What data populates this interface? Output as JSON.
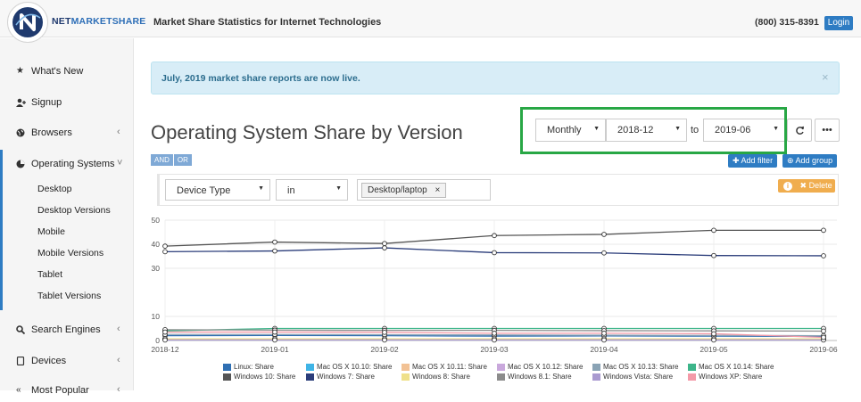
{
  "header": {
    "logo_net": "NET",
    "logo_ms": "MARKETSHARE",
    "tagline": "Market Share Statistics for Internet Technologies",
    "phone": "(800) 315-8391",
    "login_label": "Login"
  },
  "sidebar": {
    "items": [
      {
        "label": "What's New",
        "icon": "star-icon"
      },
      {
        "label": "Signup",
        "icon": "user-plus-icon"
      },
      {
        "label": "Browsers",
        "icon": "globe-icon"
      },
      {
        "label": "Operating Systems",
        "icon": "pie-chart-icon"
      },
      {
        "label": "Search Engines",
        "icon": "search-icon"
      },
      {
        "label": "Devices",
        "icon": "tablet-icon"
      },
      {
        "label": "Most Popular",
        "icon": "chevron-icon"
      }
    ],
    "subitems": [
      "Desktop",
      "Desktop Versions",
      "Mobile",
      "Mobile Versions",
      "Tablet",
      "Tablet Versions"
    ]
  },
  "alert": {
    "text": "July, 2019 market share reports are now live.",
    "close": "×"
  },
  "page_title": "Operating System Share by Version",
  "controls": {
    "period": "Monthly",
    "from": "2018-12",
    "to_label": "to",
    "to": "2019-06",
    "refresh_icon": "refresh-icon",
    "more_label": "•••",
    "and_label": "AND",
    "or_label": "OR",
    "add_filter": "Add filter",
    "add_group": "Add group"
  },
  "filter": {
    "field": "Device Type",
    "operator": "in",
    "value_tag": "Desktop/laptop",
    "tag_remove": "×",
    "delete_label": "Delete",
    "info_label": "i"
  },
  "chart_data": {
    "type": "line",
    "x": [
      "2018-12",
      "2019-01",
      "2019-02",
      "2019-03",
      "2019-04",
      "2019-05",
      "2019-06"
    ],
    "ylim": [
      0,
      50
    ],
    "yticks": [
      0,
      10,
      30,
      40,
      50
    ],
    "series": [
      {
        "name": "Linux: Share",
        "color": "#2f6fb3",
        "values": [
          2.0,
          2.1,
          2.0,
          1.8,
          1.9,
          1.8,
          1.7
        ]
      },
      {
        "name": "Mac OS X 10.10: Share",
        "color": "#3fb4e6",
        "values": [
          0.5,
          0.5,
          0.5,
          0.4,
          0.4,
          0.4,
          0.4
        ]
      },
      {
        "name": "Mac OS X 10.11: Share",
        "color": "#f2c295",
        "values": [
          0.6,
          0.6,
          0.6,
          0.5,
          0.5,
          0.5,
          0.5
        ]
      },
      {
        "name": "Mac OS X 10.12: Share",
        "color": "#c9a8dc",
        "values": [
          0.7,
          0.7,
          0.6,
          0.6,
          0.6,
          0.5,
          0.5
        ]
      },
      {
        "name": "Mac OS X 10.13: Share",
        "color": "#8aa3b5",
        "values": [
          2.5,
          2.5,
          2.4,
          2.3,
          2.2,
          2.1,
          2.0
        ]
      },
      {
        "name": "Mac OS X 10.14: Share",
        "color": "#3db58a",
        "values": [
          4.0,
          5.0,
          5.0,
          5.0,
          5.0,
          5.0,
          5.0
        ]
      },
      {
        "name": "Windows 10: Share",
        "color": "#555555",
        "values": [
          39.2,
          40.9,
          40.3,
          43.6,
          44.1,
          45.8,
          45.8
        ]
      },
      {
        "name": "Windows 7: Share",
        "color": "#2b3d7a",
        "values": [
          36.9,
          37.2,
          38.5,
          36.5,
          36.4,
          35.3,
          35.2
        ]
      },
      {
        "name": "Windows 8: Share",
        "color": "#efe08a",
        "values": [
          0.7,
          0.7,
          0.7,
          0.7,
          0.7,
          0.7,
          0.7
        ]
      },
      {
        "name": "Windows 8.1: Share",
        "color": "#8c8c8c",
        "values": [
          4.5,
          4.3,
          4.2,
          4.2,
          4.1,
          4.0,
          3.9
        ]
      },
      {
        "name": "Windows Vista: Share",
        "color": "#a99ad0",
        "values": [
          0.2,
          0.2,
          0.2,
          0.2,
          0.2,
          0.2,
          0.2
        ]
      },
      {
        "name": "Windows XP: Share",
        "color": "#f49aa8",
        "values": [
          3.5,
          3.5,
          3.4,
          3.0,
          3.0,
          2.8,
          1.3
        ]
      }
    ]
  }
}
